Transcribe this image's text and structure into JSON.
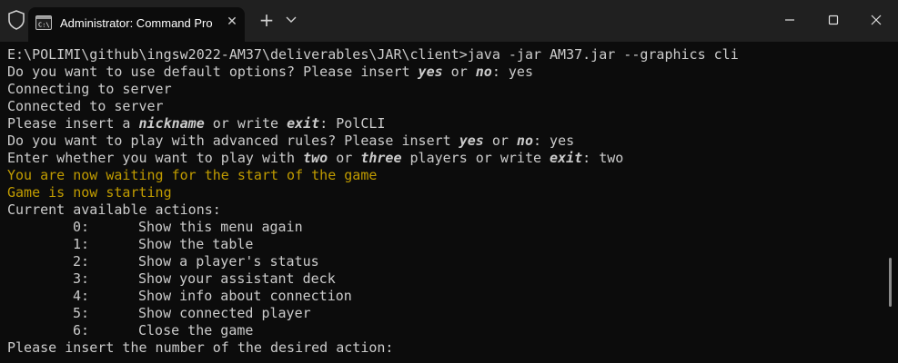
{
  "window": {
    "tab_title": "Administrator: Command Pro",
    "colors": {
      "titlebar": "#202020",
      "terminal_bg": "#0c0c0c",
      "text": "#cccccc",
      "yellow": "#c19c00"
    }
  },
  "terminal": {
    "command_line": "E:\\POLIMI\\github\\ingsw2022-AM37\\deliverables\\JAR\\client>java -jar AM37.jar --graphics cli",
    "default_prompt": "Do you want to use default options? Please insert ",
    "default_yes": "yes",
    "default_or": " or ",
    "default_no": "no",
    "default_answer": ": yes",
    "connecting": "Connecting to server",
    "connected": "Connected to server",
    "nickname_prefix": "Please insert a ",
    "nickname_kw": "nickname",
    "nickname_mid": " or write ",
    "nickname_exit": "exit",
    "nickname_answer": ": PolCLI",
    "advanced_prefix": "Do you want to play with advanced rules? Please insert ",
    "advanced_yes": "yes",
    "advanced_or": " or ",
    "advanced_no": "no",
    "advanced_answer": ": yes",
    "players_prefix": "Enter whether you want to play with ",
    "players_two": "two",
    "players_or": " or ",
    "players_three": "three",
    "players_mid": " players or write ",
    "players_exit": "exit",
    "players_answer": ": two",
    "waiting": "You are now waiting for the start of the game",
    "starting": "Game is now starting",
    "actions_header": "Current available actions:",
    "actions": [
      {
        "key": "0:",
        "label": "Show this menu again"
      },
      {
        "key": "1:",
        "label": "Show the table"
      },
      {
        "key": "2:",
        "label": "Show a player's status"
      },
      {
        "key": "3:",
        "label": "Show your assistant deck"
      },
      {
        "key": "4:",
        "label": "Show info about connection"
      },
      {
        "key": "5:",
        "label": "Show connected player"
      },
      {
        "key": "6:",
        "label": "Close the game"
      }
    ],
    "final_prompt": "Please insert the number of the desired action:"
  }
}
